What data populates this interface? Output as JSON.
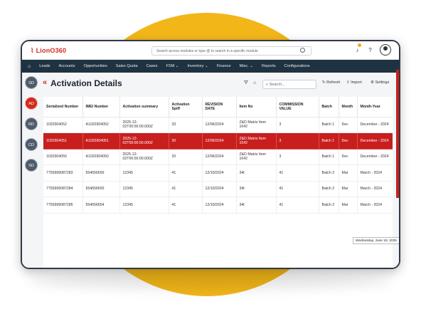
{
  "app": {
    "logo": "LionO360"
  },
  "search": {
    "placeholder": "Search across modules or type @ to search in a specific module"
  },
  "nav": {
    "items": [
      "Leads",
      "Accounts",
      "Opportunities",
      "Sales Quota",
      "Cases",
      "FSM ⌄",
      "Inventory ⌄",
      "Finance",
      "Misc. ⌄",
      "Reports",
      "Configurations"
    ]
  },
  "sidebar": {
    "items": [
      "SD",
      "AD",
      "RD",
      "CD",
      "SD"
    ],
    "active_index": 1
  },
  "page": {
    "title": "Activation Details",
    "search_placeholder": "Search...",
    "refresh_label": "Refresh",
    "import_label": "Import",
    "settings_label": "Settings"
  },
  "table": {
    "columns": [
      "Serialized Number",
      "IMEI Number",
      "Activation summary",
      "Activation Spiff",
      "REVISION DATE",
      "Item No",
      "COMMISSION VALUE",
      "Batch",
      "Month",
      "Month-Year"
    ],
    "rows": [
      [
        "1020304052",
        "A1020304052",
        "2025-12-02T00:00:00.000Z",
        "33",
        "12/06/2024",
        "Z&D Matrix Item 1042",
        "3",
        "Batch 1",
        "Dec",
        "December - 2024"
      ],
      [
        "1020304051",
        "A1020304051",
        "2025-12-02T00:00:00.000Z",
        "30",
        "12/06/2024",
        "Z&D Matrix Item 1042",
        "3",
        "Batch 1",
        "Dec",
        "December - 2024"
      ],
      [
        "1020304050",
        "A1020304050",
        "2025-12-02T00:00:00.000Z",
        "20",
        "12/06/2024",
        "Z&D Matrix Item 1042",
        "3",
        "Batch 1",
        "Dec",
        "December - 2024"
      ],
      [
        "7755999087283",
        "554656656",
        "12345",
        "41",
        "12/10/2024",
        "34t",
        "41",
        "Batch 2",
        "Mar",
        "March - 2024"
      ],
      [
        "7755999087284",
        "554656655",
        "12345",
        "41",
        "12/10/2024",
        "34t",
        "41",
        "Batch 2",
        "Mar",
        "March - 2024"
      ],
      [
        "7755999087285",
        "554656654",
        "12345",
        "41",
        "12/10/2024",
        "34t",
        "41",
        "Batch 2",
        "Mar",
        "March - 2024"
      ]
    ],
    "selected_row_index": 1
  },
  "tooltip": {
    "text": "Wednesday, June 18, 2025"
  },
  "colors": {
    "accent": "#d32a1e",
    "nav_bg": "#1f3241",
    "backdrop": "#f2b619",
    "selected_row": "#c81e1e"
  }
}
